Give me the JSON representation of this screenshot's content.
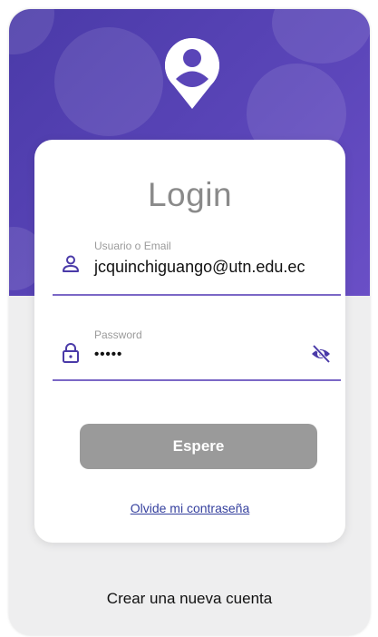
{
  "header": {
    "avatar_icon": "user-avatar-icon",
    "colors": {
      "gradient_start": "#4a3aa8",
      "gradient_end": "#6a4fc6"
    }
  },
  "card": {
    "title": "Login",
    "username": {
      "label": "Usuario o Email",
      "value": "jcquinchiguango@utn.edu.ec",
      "icon": "person-outline-icon"
    },
    "password": {
      "label": "Password",
      "value": "•••••",
      "icon": "lock-outline-icon",
      "toggle_icon": "eye-off-icon"
    },
    "submit_label": "Espere",
    "forgot_link": "Olvide mi contraseña",
    "colors": {
      "accent": "#5b47b8",
      "button_disabled": "#9a9a9a",
      "link": "#35409e"
    }
  },
  "footer": {
    "create_account": "Crear una nueva cuenta"
  }
}
